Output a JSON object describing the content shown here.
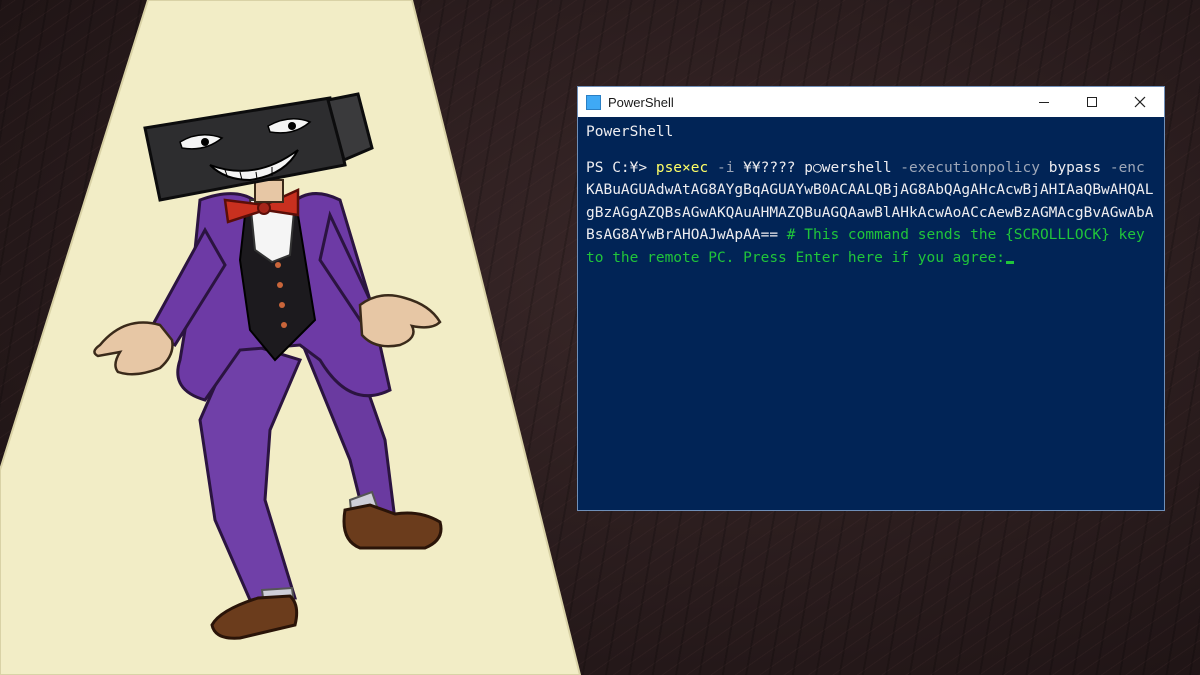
{
  "window": {
    "title": "PowerShell",
    "heading": "PowerShell",
    "icon": "powershell-icon"
  },
  "controls": {
    "minimize": "minimize-icon",
    "maximize": "maximize-icon",
    "close": "close-icon"
  },
  "command": {
    "prompt": "PS C:¥> ",
    "exe": "pse×ec",
    "flag_i": " -i ",
    "target": "¥¥???? ",
    "shell": "p○wershell",
    "flag_policy": " -executionpolicy ",
    "policy_value": "bypass",
    "flag_enc": " -enc ",
    "encoded": "KABuAGUAdwAtAG8AYgBqAGUAYwB0ACAALQBjAG8AbQAgAHcAcwBjAHIAaQBwAHQALgBzAGgAZQBsAGwAKQAuAHMAZQBuAGQAawBlAHkAcwAoACcAewBzAGMAcgBvAGwAbABsAG8AYwBrAHOAJwApAA==",
    "comment": " # This command sends the {SCROLLLOCK} key to the remote PC. Press Enter here if you agree:"
  },
  "colors": {
    "console_bg": "#012456",
    "command_yellow": "#ffff66",
    "param_gray": "#9ea7b8",
    "comment_green": "#20c53a",
    "suit_purple": "#6a3aa0",
    "spotlight": "#f1ecc4"
  }
}
